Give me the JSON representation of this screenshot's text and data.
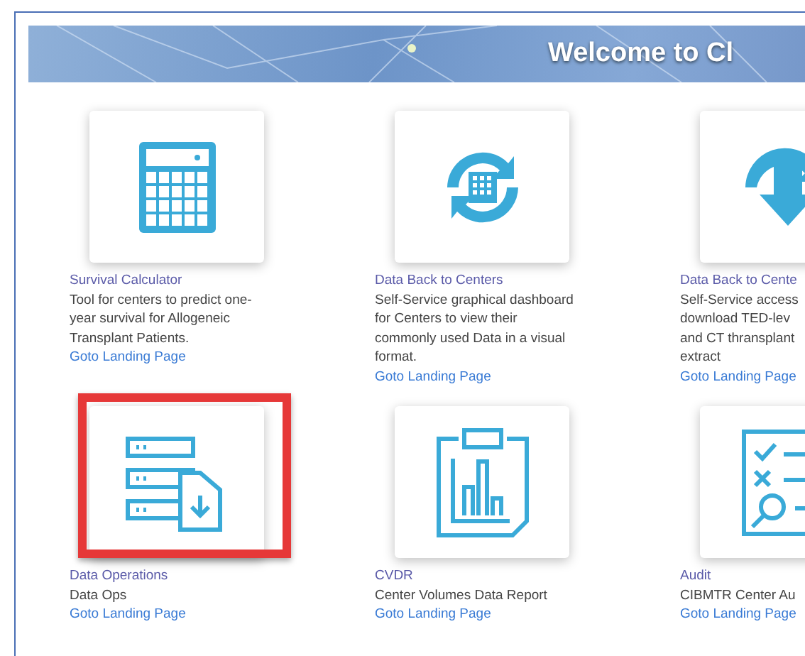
{
  "banner": {
    "title": "Welcome to Cl"
  },
  "tiles": [
    {
      "title": "Survival Calculator",
      "description": [
        "Tool for centers to predict one-",
        "year survival for Allogeneic",
        "Transplant Patients."
      ],
      "link": "Goto Landing Page",
      "highlighted": false
    },
    {
      "title": "Data Back to Centers",
      "description": [
        "Self-Service graphical dashboard",
        "for Centers to view their",
        "commonly used Data in a visual",
        "format."
      ],
      "link": "Goto Landing Page",
      "highlighted": false
    },
    {
      "title": "Data Back to Cente",
      "description": [
        "Self-Service access",
        "download TED-lev",
        "and CT thransplant",
        "extract"
      ],
      "link": "Goto Landing Page",
      "highlighted": false
    },
    {
      "title": "Data Operations",
      "description": [
        "Data Ops"
      ],
      "link": "Goto Landing Page",
      "highlighted": true
    },
    {
      "title": "CVDR",
      "description": [
        "Center Volumes Data Report"
      ],
      "link": "Goto Landing Page",
      "highlighted": false
    },
    {
      "title": "Audit",
      "description": [
        "CIBMTR Center Au"
      ],
      "link": "Goto Landing Page",
      "highlighted": false
    }
  ]
}
